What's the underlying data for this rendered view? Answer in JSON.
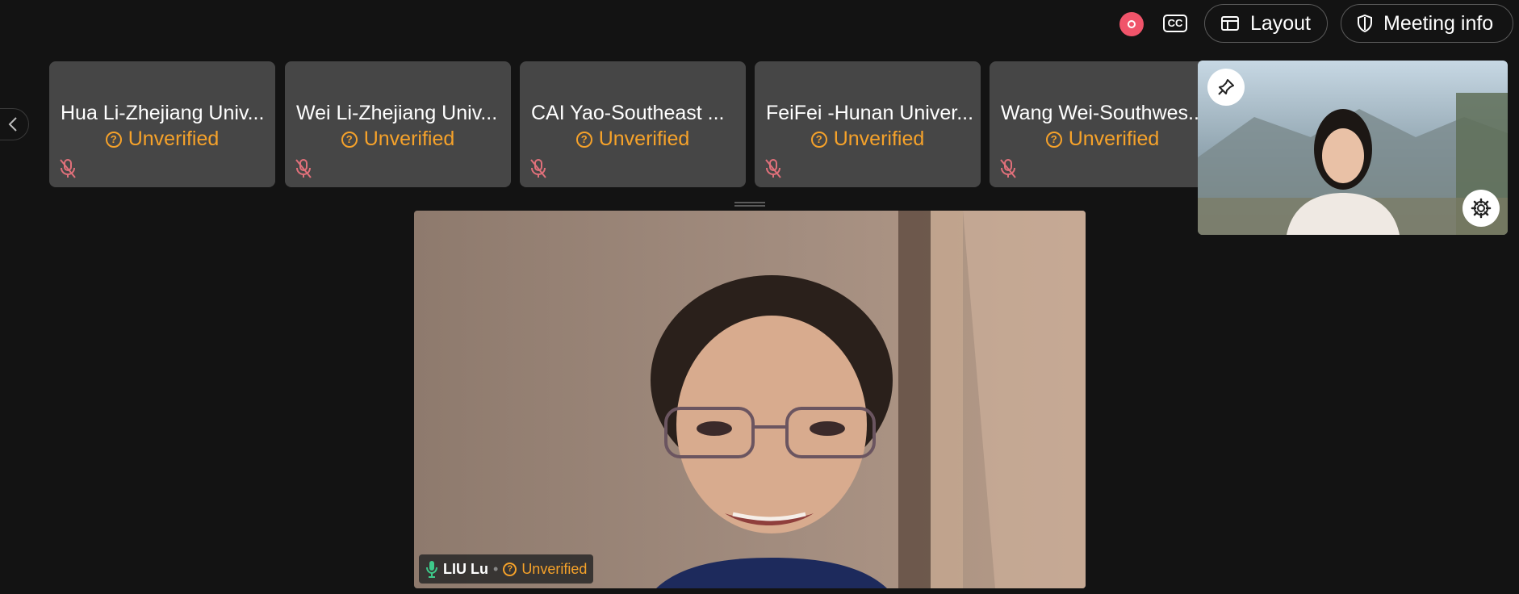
{
  "top_bar": {
    "cc_label": "CC",
    "layout_label": "Layout",
    "meeting_info_label": "Meeting info"
  },
  "participants": [
    {
      "name": "Hua Li-Zhejiang Univ...",
      "status": "Unverified"
    },
    {
      "name": "Wei Li-Zhejiang Univ...",
      "status": "Unverified"
    },
    {
      "name": "CAI Yao-Southeast ...",
      "status": "Unverified"
    },
    {
      "name": "FeiFei -Hunan Univer...",
      "status": "Unverified"
    },
    {
      "name": "Wang Wei-Southwes...",
      "status": "Unverified"
    }
  ],
  "main_speaker": {
    "name": "LIU Lu",
    "separator": "•",
    "status": "Unverified"
  },
  "colors": {
    "background": "#131313",
    "tile": "#464646",
    "unverified": "#f6a22a",
    "recording": "#f0546a",
    "mic_active": "#3ec98a",
    "muted": "#e0707a"
  },
  "icons": [
    "recording-icon",
    "closed-captions-icon",
    "layout-icon",
    "shield-icon",
    "chevron-left-icon",
    "question-icon",
    "microphone-muted-icon",
    "pin-icon",
    "gear-icon",
    "microphone-icon"
  ]
}
